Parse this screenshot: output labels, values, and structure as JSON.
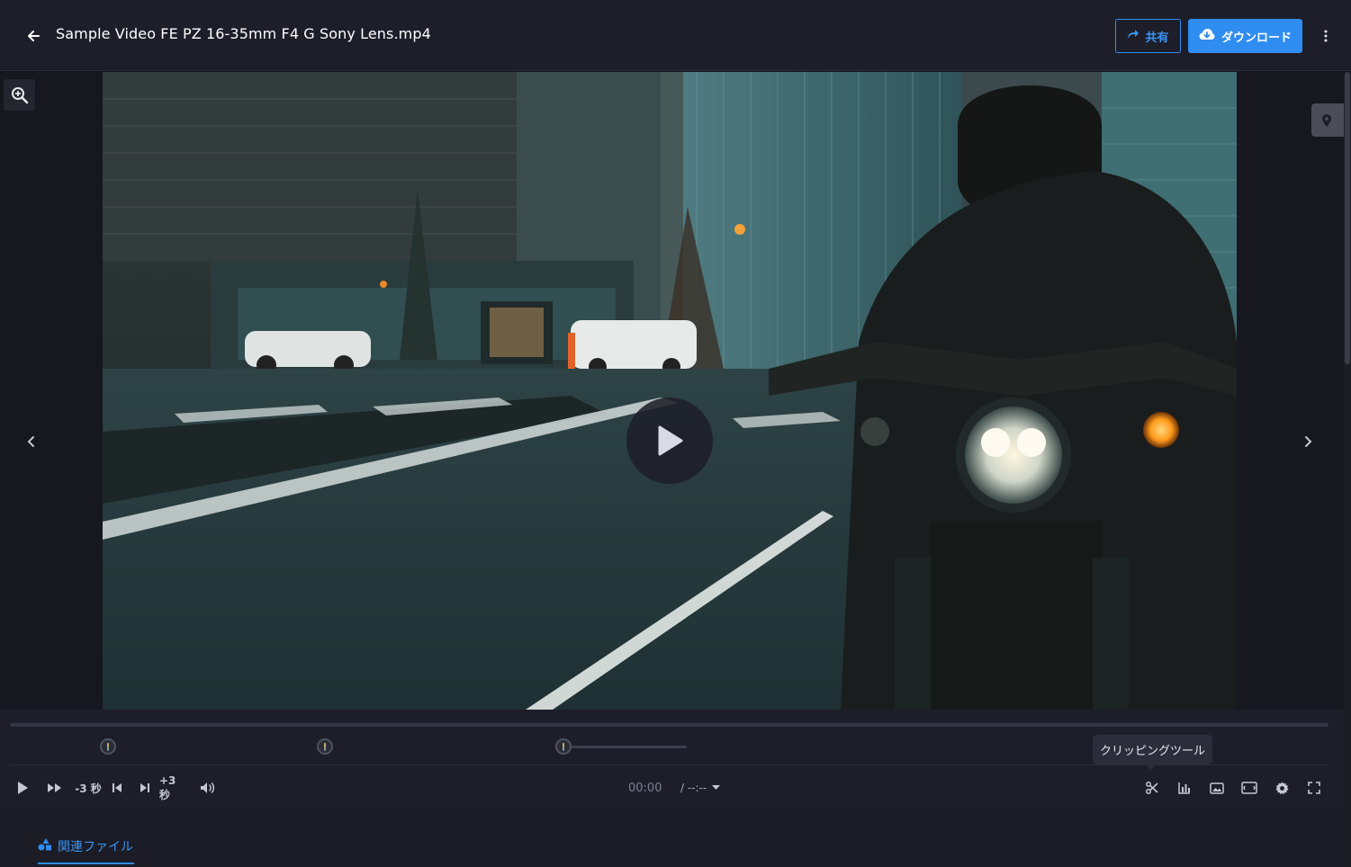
{
  "header": {
    "title": "Sample Video FE PZ 16-35mm F4 G Sony Lens.mp4",
    "share_label": "共有",
    "download_label": "ダウンロード"
  },
  "player": {
    "skip_back_label": "-3 秒",
    "skip_forward_label": "+3 秒",
    "current_time": "00:00",
    "total_time": "/ --:--",
    "tooltip": "クリッピングツール",
    "progress": 0
  },
  "tabs": {
    "related_files_label": "関連ファイル"
  },
  "colors": {
    "accent": "#2f8cf0",
    "header_bg": "#1d1e2a",
    "page_bg": "#14151c"
  },
  "icons": [
    "back-arrow-icon",
    "share-icon",
    "cloud-download-icon",
    "more-vertical-icon",
    "zoom-in-icon",
    "map-pin-icon",
    "chevron-left-icon",
    "chevron-right-icon",
    "play-icon",
    "fast-forward-icon",
    "skip-previous-icon",
    "skip-next-icon",
    "volume-icon",
    "scissors-icon",
    "chart-icon",
    "image-icon",
    "aspect-ratio-icon",
    "settings-icon",
    "fullscreen-icon",
    "shapes-icon"
  ]
}
